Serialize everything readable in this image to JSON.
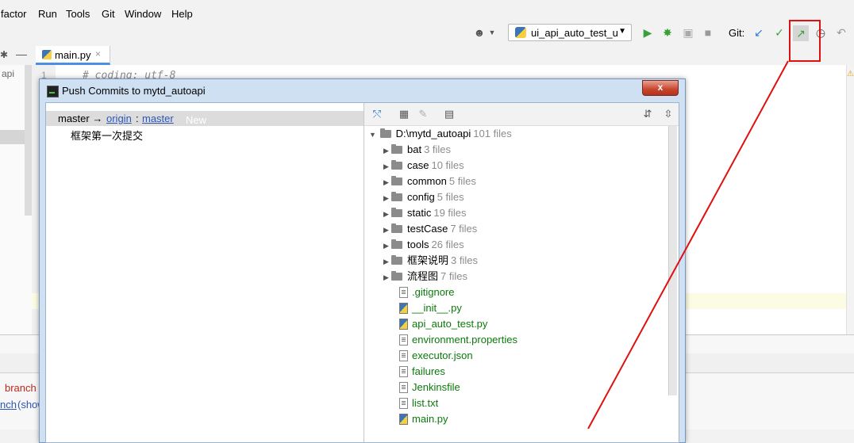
{
  "menubar": {
    "items": [
      "factor",
      "Run",
      "Tools",
      "Git",
      "Window",
      "Help"
    ]
  },
  "toolbar": {
    "run_config": "ui_api_auto_test_u",
    "git_label": "Git:"
  },
  "editor": {
    "tab_label": "main.py",
    "first_line": "# coding: utf-8",
    "gutter_line_1": "1",
    "project_label": "api"
  },
  "bottom_panel": {
    "line1": "branch",
    "line2_prefix": "nch",
    "line2_link": "(show"
  },
  "dialog": {
    "title": "Push Commits to mytd_autoapi",
    "close_label": "x",
    "branch": {
      "local": "master →",
      "remote": "origin",
      "separator": ":",
      "target": "master",
      "tag": "New"
    },
    "commit_message": "框架第一次提交",
    "tree": {
      "root": {
        "name": "D:\\mytd_autoapi",
        "count": "101 files"
      },
      "folders": [
        {
          "name": "bat",
          "count": "3 files"
        },
        {
          "name": "case",
          "count": "10 files"
        },
        {
          "name": "common",
          "count": "5 files"
        },
        {
          "name": "config",
          "count": "5 files"
        },
        {
          "name": "static",
          "count": "19 files"
        },
        {
          "name": "testCase",
          "count": "7 files"
        },
        {
          "name": "tools",
          "count": "26 files"
        },
        {
          "name": "框架说明",
          "count": "3 files"
        },
        {
          "name": "流程图",
          "count": "7 files"
        }
      ],
      "files": [
        {
          "name": ".gitignore",
          "icon": "gitignore-file-icon"
        },
        {
          "name": "__init__.py",
          "icon": "python-file-icon"
        },
        {
          "name": "api_auto_test.py",
          "icon": "python-file-icon"
        },
        {
          "name": "environment.properties",
          "icon": "text-file-icon"
        },
        {
          "name": "executor.json",
          "icon": "json-file-icon"
        },
        {
          "name": "failures",
          "icon": "text-file-icon"
        },
        {
          "name": "Jenkinsfile",
          "icon": "text-file-icon"
        },
        {
          "name": "list.txt",
          "icon": "text-file-icon"
        },
        {
          "name": "main.py",
          "icon": "python-file-icon"
        }
      ]
    }
  },
  "colors": {
    "annotation_red": "#e01010",
    "file_green": "#0b7a0b",
    "link_blue": "#2c56b8"
  }
}
